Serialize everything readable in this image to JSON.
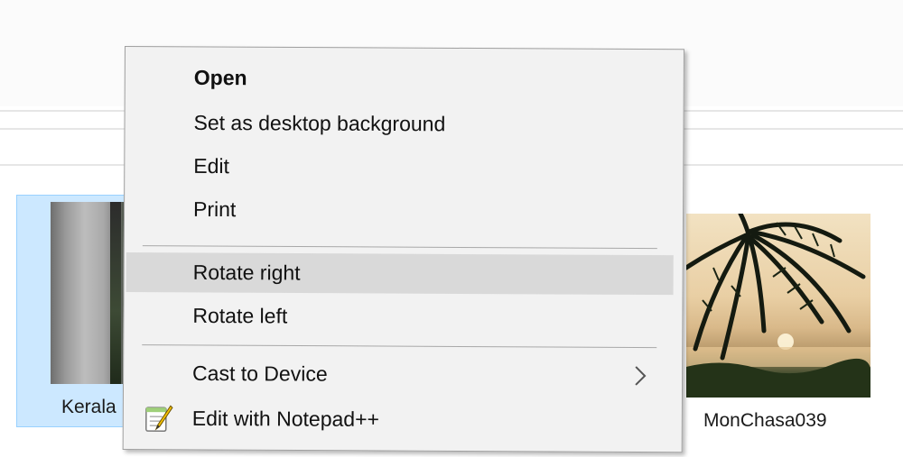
{
  "context_menu": {
    "items": [
      {
        "label": "Open",
        "bold": true,
        "icon": null
      },
      {
        "label": "Set as desktop background",
        "icon": null
      },
      {
        "label": "Edit",
        "icon": null
      },
      {
        "label": "Print",
        "icon": null
      },
      {
        "label": "Rotate right",
        "highlighted": true,
        "icon": null
      },
      {
        "label": "Rotate left",
        "icon": null
      },
      {
        "label": "Cast to Device",
        "submenu": true,
        "icon": "chevron-right-icon"
      },
      {
        "label": "Edit with Notepad++",
        "icon": "notepad-plus-plus-icon"
      }
    ]
  },
  "files": [
    {
      "name": "Kerala",
      "selected": true
    },
    {
      "name": "MonChasa039",
      "selected": false
    }
  ],
  "colors": {
    "menu_background": "#f2f2f2",
    "menu_highlight": "#d9d9d9",
    "selection_fill": "#cce8ff",
    "selection_border": "#99d1ff"
  }
}
